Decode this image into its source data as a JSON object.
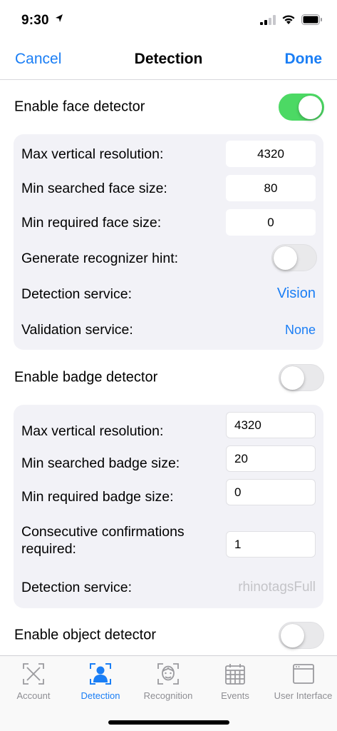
{
  "status": {
    "time": "9:30"
  },
  "nav": {
    "cancel": "Cancel",
    "title": "Detection",
    "done": "Done"
  },
  "face": {
    "label": "Enable face detector",
    "enabled": true,
    "max_vertical_resolution_label": "Max vertical resolution:",
    "max_vertical_resolution": "4320",
    "min_searched_label": "Min searched face size:",
    "min_searched": "80",
    "min_required_label": "Min required face size:",
    "min_required": "0",
    "hint_label": "Generate recognizer hint:",
    "hint_enabled": false,
    "detection_service_label": "Detection service:",
    "detection_service": "Vision",
    "validation_service_label": "Validation service:",
    "validation_service": "None"
  },
  "badge": {
    "label": "Enable badge detector",
    "enabled": false,
    "max_vertical_resolution_label": "Max vertical resolution:",
    "max_vertical_resolution": "4320",
    "min_searched_label": "Min searched badge size:",
    "min_searched": "20",
    "min_required_label": "Min required badge size:",
    "min_required": "0",
    "confirmations_label_1": "Consecutive confirmations",
    "confirmations_label_2": "required:",
    "confirmations": "1",
    "detection_service_label": "Detection service:",
    "detection_service": "rhinotagsFull"
  },
  "object": {
    "label": "Enable object detector",
    "enabled": false
  },
  "tabs": [
    {
      "label": "Account",
      "icon": "account-scan-icon",
      "active": false
    },
    {
      "label": "Detection",
      "icon": "person-scan-icon",
      "active": true
    },
    {
      "label": "Recognition",
      "icon": "face-scan-icon",
      "active": false
    },
    {
      "label": "Events",
      "icon": "calendar-icon",
      "active": false
    },
    {
      "label": "User Interface",
      "icon": "window-icon",
      "active": false
    }
  ],
  "colors": {
    "accent": "#1a7ef5",
    "toggle_on": "#4cd964",
    "card_bg": "#f2f2f7",
    "inactive_tab": "#8e8e93"
  }
}
